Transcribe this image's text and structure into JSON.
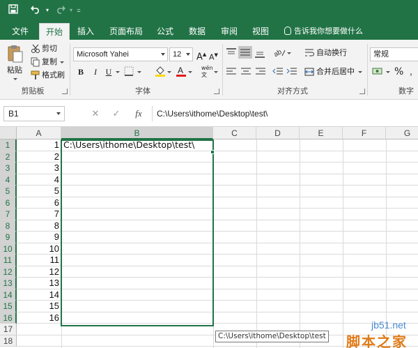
{
  "quick_access": {
    "save_icon": "save-icon",
    "undo_icon": "undo-icon",
    "redo_icon": "redo-icon",
    "customize_icon": "chevron-down-icon"
  },
  "tabs": [
    {
      "label": "文件",
      "active": false
    },
    {
      "label": "开始",
      "active": true
    },
    {
      "label": "插入",
      "active": false
    },
    {
      "label": "页面布局",
      "active": false
    },
    {
      "label": "公式",
      "active": false
    },
    {
      "label": "数据",
      "active": false
    },
    {
      "label": "审阅",
      "active": false
    },
    {
      "label": "视图",
      "active": false
    }
  ],
  "tell_me": "告诉我你想要做什么",
  "ribbon": {
    "clipboard": {
      "paste": "粘贴",
      "cut": "剪切",
      "copy": "复制",
      "format_painter": "格式刷",
      "group_label": "剪贴板"
    },
    "font": {
      "family": "Microsoft Yahei",
      "size": "12",
      "bold": "B",
      "italic": "I",
      "underline": "U",
      "group_label": "字体",
      "phonetic": "wén",
      "grow_icon": "increase-font-icon",
      "shrink_icon": "decrease-font-icon"
    },
    "alignment": {
      "wrap_text": "自动换行",
      "merge_center": "合并后居中",
      "group_label": "对齐方式"
    },
    "number": {
      "format": "常规",
      "percent": "%",
      "group_label": "数字"
    }
  },
  "formula_bar": {
    "name_box": "B1",
    "cancel_icon": "close-icon",
    "enter_icon": "check-icon",
    "fx": "fx",
    "formula": "C:\\Users\\ithome\\Desktop\\test\\"
  },
  "grid": {
    "columns": [
      "A",
      "B",
      "C",
      "D",
      "E",
      "F",
      "G"
    ],
    "selected_column": "B",
    "rows": [
      {
        "n": "1",
        "a": "1",
        "b": "C:\\Users\\ithome\\Desktop\\test\\"
      },
      {
        "n": "2",
        "a": "2"
      },
      {
        "n": "3",
        "a": "3"
      },
      {
        "n": "4",
        "a": "4"
      },
      {
        "n": "5",
        "a": "5"
      },
      {
        "n": "6",
        "a": "6"
      },
      {
        "n": "7",
        "a": "7"
      },
      {
        "n": "8",
        "a": "8"
      },
      {
        "n": "9",
        "a": "9"
      },
      {
        "n": "10",
        "a": "10"
      },
      {
        "n": "11",
        "a": "11"
      },
      {
        "n": "12",
        "a": "12"
      },
      {
        "n": "13",
        "a": "13"
      },
      {
        "n": "14",
        "a": "14"
      },
      {
        "n": "15",
        "a": "15"
      },
      {
        "n": "16",
        "a": "16"
      },
      {
        "n": "17"
      },
      {
        "n": "18"
      }
    ]
  },
  "tooltip": "C:\\Users\\ithome\\Desktop\\test",
  "watermark": {
    "site": "jb51.net",
    "brand": "脚本之家"
  },
  "colors": {
    "accent": "#217346",
    "ribbon_bg": "#f3f3f3",
    "header_bg": "#f0f0f0"
  }
}
